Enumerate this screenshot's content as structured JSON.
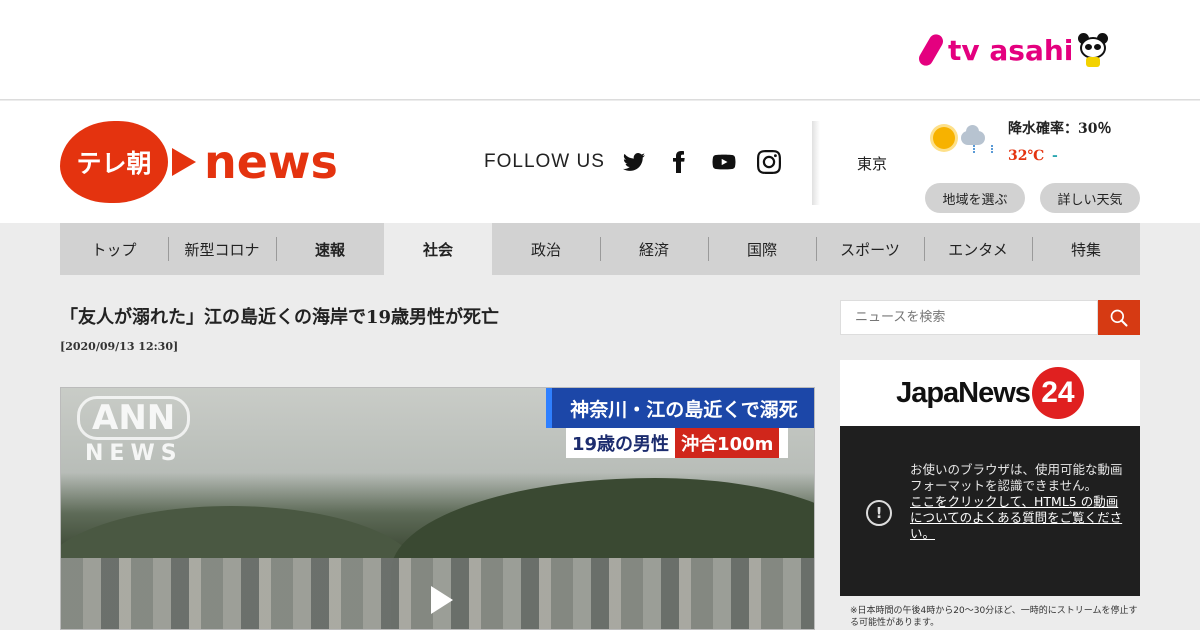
{
  "top_brand": {
    "name": "tv asahi"
  },
  "header": {
    "logo": {
      "mark": "テレ朝",
      "word": "news"
    },
    "follow": {
      "label": "FOLLOW US",
      "icons": [
        "twitter-icon",
        "facebook-icon",
        "youtube-icon",
        "instagram-icon"
      ]
    },
    "weather": {
      "city": "東京",
      "icon": "sun-cloud-rain-icon",
      "precip": "降水確率：30％",
      "temp_high": "32℃",
      "temp_low": "-",
      "region_button": "地域を選ぶ",
      "detail_button": "詳しい天気"
    }
  },
  "nav": {
    "items": [
      {
        "label": "トップ"
      },
      {
        "label": "新型コロナ"
      },
      {
        "label": "速報"
      },
      {
        "label": "社会"
      },
      {
        "label": "政治"
      },
      {
        "label": "経済"
      },
      {
        "label": "国際"
      },
      {
        "label": "スポーツ"
      },
      {
        "label": "エンタメ"
      },
      {
        "label": "特集"
      }
    ],
    "active": "社会"
  },
  "article": {
    "headline": "「友人が溺れた」江の島近くの海岸で19歳男性が死亡",
    "date": "[2020/09/13 12:30]",
    "video": {
      "watermark_top": "ANN",
      "watermark_bottom": "NEWS",
      "telop_line1": "神奈川・江の島近くで溺死",
      "telop_line2a": "19歳の男性",
      "telop_line2b": "沖合100m"
    }
  },
  "sidebar": {
    "search": {
      "placeholder": "ニュースを検索"
    },
    "promo": {
      "brand": "JapaNews",
      "badge": "24",
      "error_message": "お使いのブラウザは、使用可能な動画フォーマットを認識できません。",
      "error_link": "ここをクリックして、HTML5 の動画についてのよくある質問をご覧ください。",
      "note": "※日本時間の午後4時から20～30分ほど、一時的にストリームを停止する可能性があります。"
    }
  },
  "colors": {
    "brand_red": "#e4330f",
    "tvasahi_pink": "#e4007f",
    "nav_bg": "#d2d2d2"
  }
}
